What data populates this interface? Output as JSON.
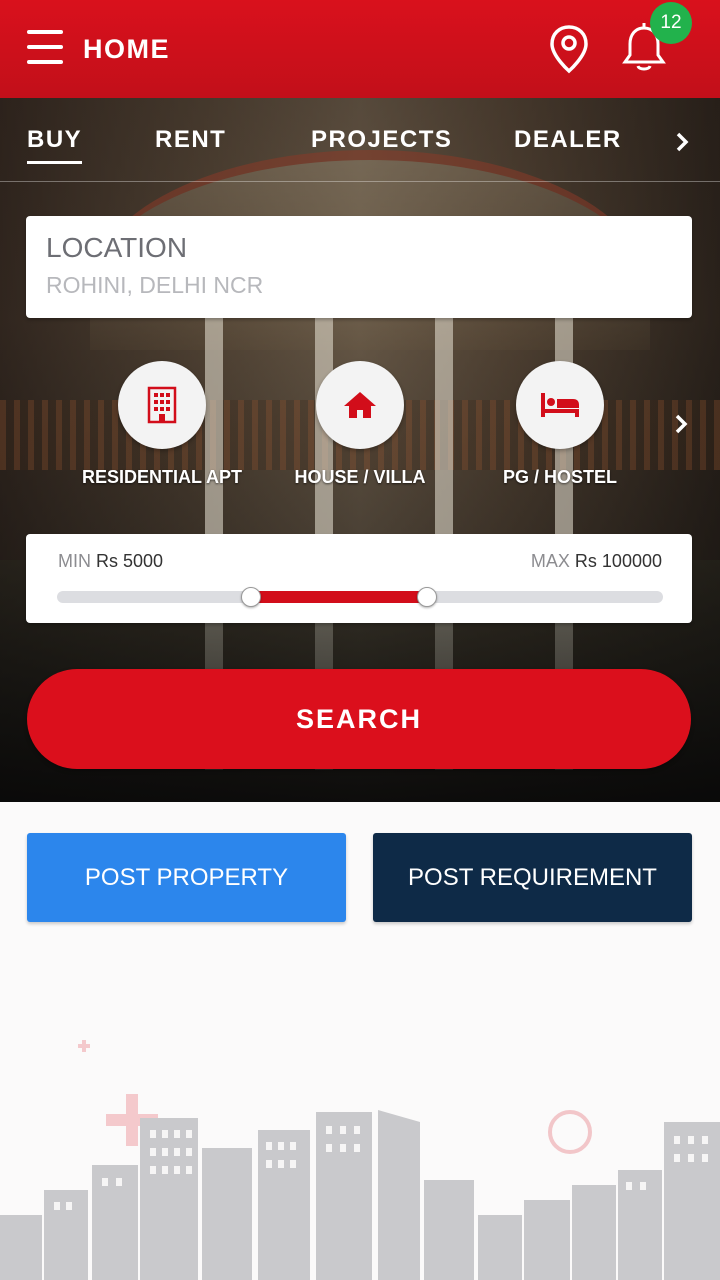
{
  "header": {
    "title": "HOME",
    "notification_count": "12",
    "colors": {
      "primary_red": "#d9111c",
      "badge_green": "#22b24c"
    }
  },
  "tabs": [
    {
      "label": "BUY",
      "active": true
    },
    {
      "label": "RENT",
      "active": false
    },
    {
      "label": "PROJECTS",
      "active": false
    },
    {
      "label": "DEALER",
      "active": false
    }
  ],
  "location": {
    "label": "LOCATION",
    "placeholder": "ROHINI, DELHI NCR"
  },
  "categories": [
    {
      "label": "RESIDENTIAL APT",
      "icon": "building-icon"
    },
    {
      "label": "HOUSE /  VILLA",
      "icon": "house-icon"
    },
    {
      "label": "PG / HOSTEL",
      "icon": "bed-icon"
    }
  ],
  "price": {
    "min_prefix": "MIN",
    "min_value": "Rs 5000",
    "max_prefix": "MAX",
    "max_value": "Rs 100000",
    "range_low_fraction": 0.32,
    "range_high_fraction": 0.61
  },
  "search": {
    "label": "SEARCH"
  },
  "actions": {
    "post_property": "POST PROPERTY",
    "post_requirement": "POST REQUIREMENT",
    "colors": {
      "post_property": "#2c86ec",
      "post_requirement": "#0e2a47"
    }
  }
}
